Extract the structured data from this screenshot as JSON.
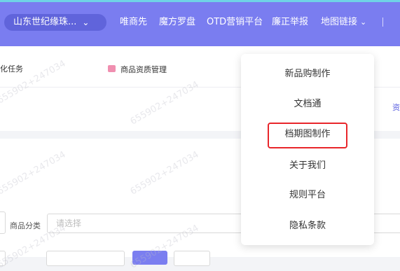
{
  "header": {
    "store_select": "山东世纪缘珠...",
    "nav": [
      "唯商先",
      "魔方罗盘",
      "OTD营销平台",
      "廉正举报",
      "地图链接"
    ]
  },
  "panel": {
    "task_text": "化任务",
    "mgmt_text": "商品资质管理",
    "right_link": "资"
  },
  "form": {
    "category_label": "商品分类",
    "category_placeholder": "请选择"
  },
  "dropdown": {
    "items": [
      "新品购制作",
      "文档通",
      "档期图制作",
      "关于我们",
      "规则平台",
      "隐私条款"
    ],
    "highlighted": "档期图制作"
  },
  "watermark": "655902+247034",
  "colors": {
    "header_bg": "#7a7df0",
    "store_select_bg": "#6064db",
    "accent": "#6fd3e6",
    "highlight_border": "#e8262b"
  }
}
